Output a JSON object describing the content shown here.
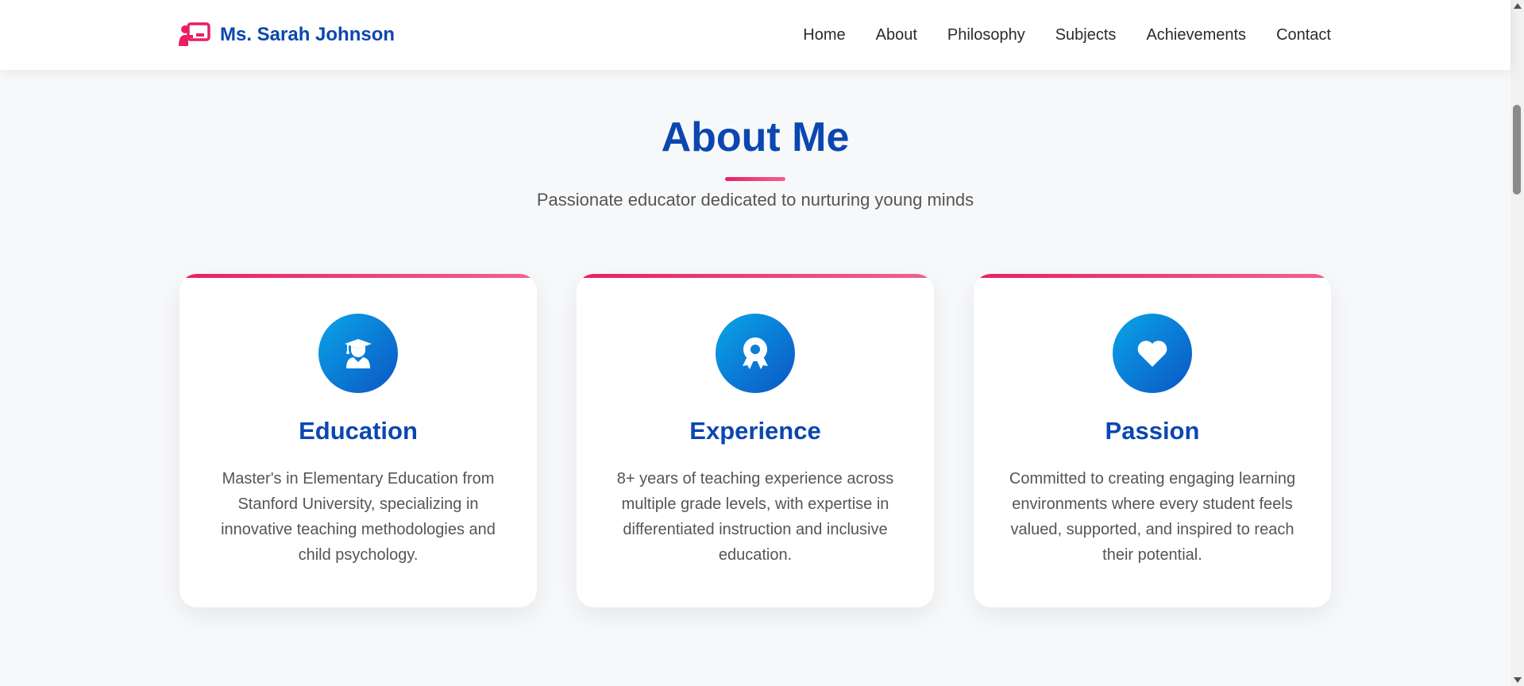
{
  "navbar": {
    "brand_name": "Ms. Sarah Johnson",
    "brand_icon": "chalkboard-teacher-icon",
    "links": [
      "Home",
      "About",
      "Philosophy",
      "Subjects",
      "Achievements",
      "Contact"
    ]
  },
  "section": {
    "title": "About Me",
    "subtitle": "Passionate educator dedicated to nurturing young minds"
  },
  "cards": [
    {
      "icon": "graduate-icon",
      "title": "Education",
      "text": "Master's in Elementary Education from Stanford University, specializing in innovative teaching methodologies and child psychology."
    },
    {
      "icon": "award-icon",
      "title": "Experience",
      "text": "8+ years of teaching experience across multiple grade levels, with expertise in differentiated instruction and inclusive education."
    },
    {
      "icon": "heart-icon",
      "title": "Passion",
      "text": "Committed to creating engaging learning environments where every student feels valued, supported, and inspired to reach their potential."
    }
  ],
  "colors": {
    "primary": "#0b47b0",
    "accent": "#e91e63",
    "icon_gradient_start": "#0aa5e8",
    "icon_gradient_end": "#0b56c4",
    "background": "#f7f8fa"
  }
}
